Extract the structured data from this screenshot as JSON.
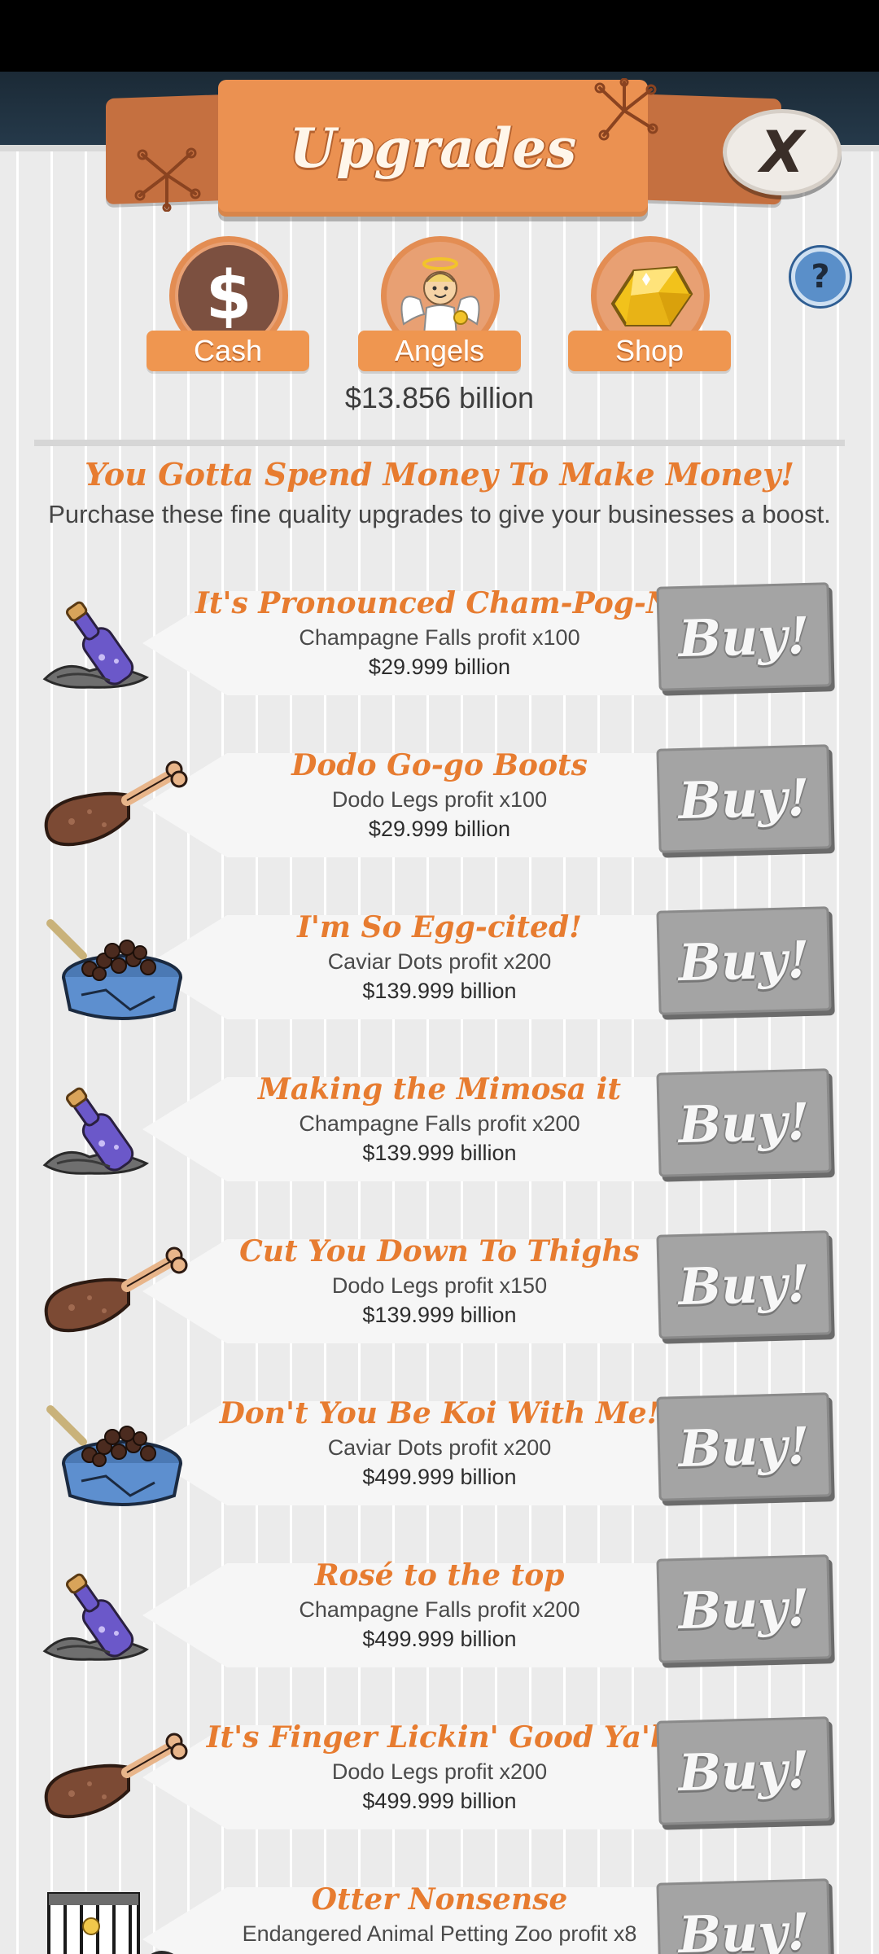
{
  "header": {
    "title": "Upgrades",
    "close_label": "X",
    "help_label": "?"
  },
  "tabs": [
    {
      "label": "Cash",
      "icon": "dollar-icon"
    },
    {
      "label": "Angels",
      "icon": "angel-icon"
    },
    {
      "label": "Shop",
      "icon": "gold-icon"
    }
  ],
  "balance": "$13.856 billion",
  "section": {
    "heading": "You Gotta Spend Money To Make Money!",
    "subtext": "Purchase these fine quality upgrades to give your businesses a boost."
  },
  "buy_label": "Buy!",
  "upgrades": [
    {
      "title": "It's Pronounced Cham-Pog-Na",
      "description": "Champagne Falls profit x100",
      "price": "$29.999 billion",
      "icon": "champagne-bottle-icon"
    },
    {
      "title": "Dodo Go-go Boots",
      "description": "Dodo Legs profit x100",
      "price": "$29.999 billion",
      "icon": "dodo-leg-icon"
    },
    {
      "title": "I'm So Egg-cited!",
      "description": "Caviar Dots profit x200",
      "price": "$139.999 billion",
      "icon": "caviar-tin-icon"
    },
    {
      "title": "Making the Mimosa it",
      "description": "Champagne Falls profit x200",
      "price": "$139.999 billion",
      "icon": "champagne-bottle-icon"
    },
    {
      "title": "Cut You Down To Thighs",
      "description": "Dodo Legs profit x150",
      "price": "$139.999 billion",
      "icon": "dodo-leg-icon"
    },
    {
      "title": "Don't You Be Koi With Me!",
      "description": "Caviar Dots profit x200",
      "price": "$499.999 billion",
      "icon": "caviar-tin-icon"
    },
    {
      "title": "Rosé to the top",
      "description": "Champagne Falls profit x200",
      "price": "$499.999 billion",
      "icon": "champagne-bottle-icon"
    },
    {
      "title": "It's Finger Lickin' Good Ya'll",
      "description": "Dodo Legs profit x200",
      "price": "$499.999 billion",
      "icon": "dodo-leg-icon"
    },
    {
      "title": "Otter Nonsense",
      "description": "Endangered Animal Petting Zoo profit x8",
      "price": "",
      "icon": "zoo-cage-icon"
    }
  ]
}
